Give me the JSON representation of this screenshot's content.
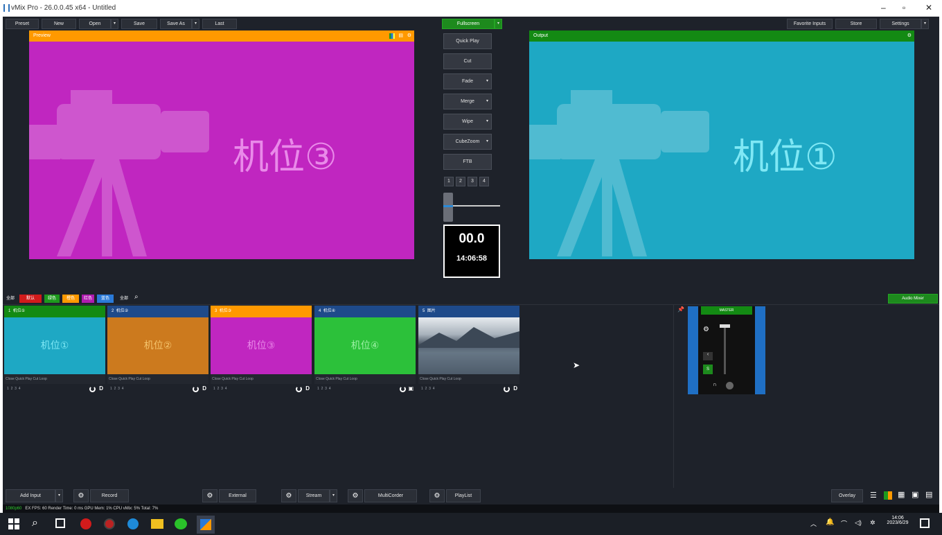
{
  "window": {
    "title": "vMix Pro - 26.0.0.45 x64 - Untitled"
  },
  "toolbar": {
    "buttons": [
      "Preset",
      "New",
      "Open",
      "Save",
      "Save As",
      "Last"
    ],
    "center": "Fullscreen",
    "right": [
      "Favorite Inputs",
      "Store",
      "Settings"
    ]
  },
  "preview": {
    "header": "Preview",
    "label": "机位③",
    "bg": "#c026c0",
    "head_color": "#ff9900"
  },
  "output": {
    "header": "Output",
    "label": "机位①",
    "bg": "#1ea8c4",
    "head_color": "#138a13"
  },
  "transitions": {
    "buttons": [
      "Quick Play",
      "Cut",
      "Fade",
      "Merge",
      "Wipe",
      "CubeZoom",
      "FTB"
    ],
    "numbers": [
      "1",
      "2",
      "3",
      "4"
    ],
    "timer": "00.0",
    "clock": "14:06:58"
  },
  "filters": {
    "tags": [
      {
        "label": "全部",
        "color": "#1e222a"
      },
      {
        "label": "默认",
        "color": "#d11b1b"
      },
      {
        "label": "绿色",
        "color": "#1d9a1d"
      },
      {
        "label": "橙色",
        "color": "#ff9900"
      },
      {
        "label": "红色",
        "color": "#b01bb0"
      },
      {
        "label": "蓝色",
        "color": "#2a7ad8"
      },
      {
        "label": "全部",
        "color": "#1e222a"
      }
    ],
    "audio_mixer": "Audio Mixer"
  },
  "inputs": [
    {
      "num": "1",
      "name": "机位①",
      "label": "机位①",
      "head": "#138a13",
      "bg": "#1ea8c4",
      "text": "#7fe8f5"
    },
    {
      "num": "2",
      "name": "机位②",
      "label": "机位②",
      "head": "#1e4a8a",
      "bg": "#cc7a1e",
      "text": "#f5c56e"
    },
    {
      "num": "3",
      "name": "机位③",
      "label": "机位③",
      "head": "#ff9900",
      "bg": "#c026c0",
      "text": "#e98ae9"
    },
    {
      "num": "4",
      "name": "机位④",
      "label": "机位④",
      "head": "#1e4a8a",
      "bg": "#2cc13a",
      "text": "#9df0a5"
    },
    {
      "num": "5",
      "name": "图片",
      "label": "",
      "head": "#1e4a8a",
      "bg": "landscape",
      "text": "#fff"
    }
  ],
  "input_controls": {
    "row1": "Close  Quick Play  Cut  Loop",
    "row2": [
      "1",
      "2",
      "3",
      "4"
    ]
  },
  "mixer": {
    "master": "MASTER"
  },
  "bottom": {
    "buttons": [
      "Add Input",
      "Record",
      "External",
      "Stream",
      "MultiCorder",
      "PlayList",
      "Overlay"
    ]
  },
  "status": {
    "fps": "1080p60",
    "text": "EX  FPS: 60   Render Time: 0 ms   GPU Mem: 1%   CPU vMix: 5%   Total: 7%"
  },
  "taskbar": {
    "time": "14:06",
    "date": "2023/6/29"
  }
}
